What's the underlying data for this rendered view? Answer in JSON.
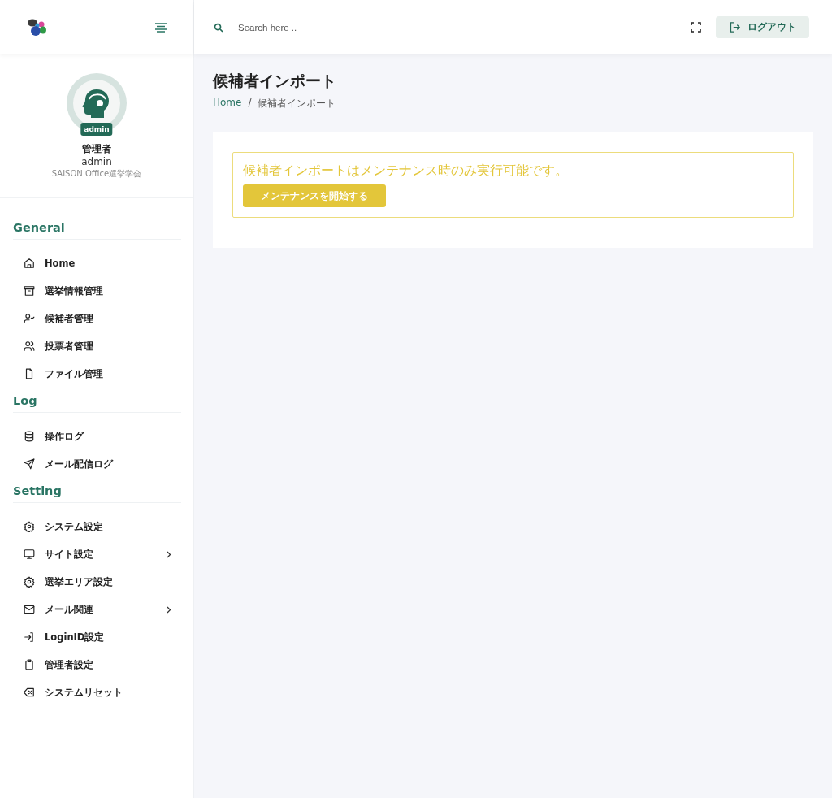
{
  "header": {
    "search": {
      "placeholder": "Search here .."
    },
    "logout_button": "ログアウト"
  },
  "profile": {
    "badge": "admin",
    "name": "管理者",
    "username": "admin",
    "organization": "SAISON Office選挙学会"
  },
  "sidebar": {
    "sections": [
      {
        "title": "General",
        "items": [
          {
            "label": "Home",
            "kind": "home",
            "has_submenu": false
          },
          {
            "label": "選挙情報管理",
            "kind": "archive",
            "has_submenu": false
          },
          {
            "label": "候補者管理",
            "kind": "user-check",
            "has_submenu": false
          },
          {
            "label": "投票者管理",
            "kind": "users",
            "has_submenu": false
          },
          {
            "label": "ファイル管理",
            "kind": "file",
            "has_submenu": false
          }
        ]
      },
      {
        "title": "Log",
        "items": [
          {
            "label": "操作ログ",
            "kind": "database",
            "has_submenu": false
          },
          {
            "label": "メール配信ログ",
            "kind": "send",
            "has_submenu": false
          }
        ]
      },
      {
        "title": "Setting",
        "items": [
          {
            "label": "システム設定",
            "kind": "gear",
            "has_submenu": false
          },
          {
            "label": "サイト設定",
            "kind": "monitor",
            "has_submenu": true
          },
          {
            "label": "選挙エリア設定",
            "kind": "gear",
            "has_submenu": false
          },
          {
            "label": "メール関連",
            "kind": "mail",
            "has_submenu": true
          },
          {
            "label": "LoginID設定",
            "kind": "login",
            "has_submenu": false
          },
          {
            "label": "管理者設定",
            "kind": "clipboard",
            "has_submenu": false
          },
          {
            "label": "システムリセット",
            "kind": "backspace",
            "has_submenu": false
          }
        ]
      }
    ]
  },
  "page": {
    "title": "候補者インポート",
    "breadcrumb": [
      "Home",
      "候補者インポート"
    ],
    "breadcrumb_separator": "/",
    "alert": {
      "message": "候補者インポートはメンテナンス時のみ実行可能です。",
      "button": "メンテナンスを開始する"
    }
  }
}
